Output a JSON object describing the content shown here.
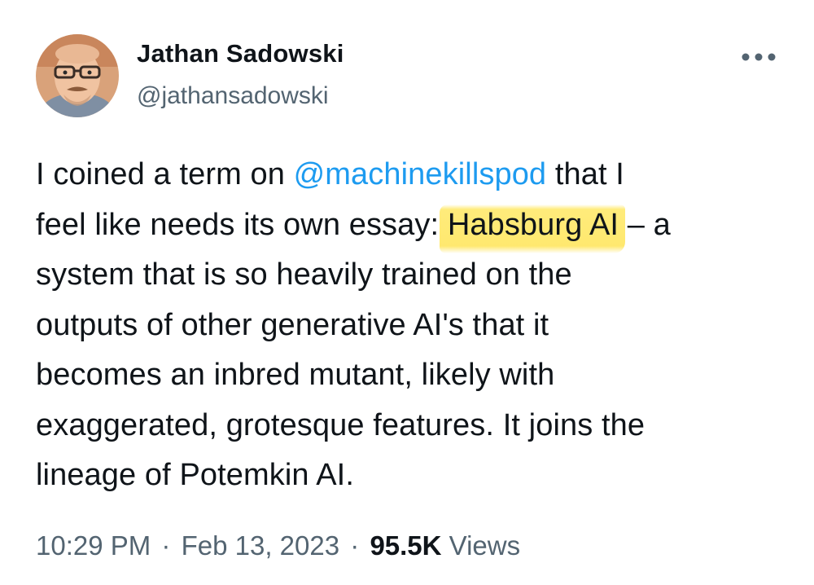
{
  "author": {
    "display_name": "Jathan Sadowski",
    "handle": "@jathansadowski",
    "avatar_icon": "profile-photo-icon"
  },
  "more_icon": "ellipsis-icon",
  "tweet": {
    "lines": [
      [
        {
          "text": "I coined a term on ",
          "type": "text"
        },
        {
          "text": "@machinekillspod",
          "type": "mention"
        },
        {
          "text": " that I",
          "type": "text"
        }
      ],
      [
        {
          "text": "feel like needs its own essay: ",
          "type": "text"
        },
        {
          "text": "Habsburg AI",
          "type": "highlight"
        },
        {
          "text": " – a",
          "type": "text"
        }
      ],
      [
        {
          "text": "system that is so heavily trained on the",
          "type": "text"
        }
      ],
      [
        {
          "text": "outputs of other generative AI's that it",
          "type": "text"
        }
      ],
      [
        {
          "text": "becomes an inbred mutant, likely with",
          "type": "text"
        }
      ],
      [
        {
          "text": "exaggerated, grotesque features. It joins the",
          "type": "text"
        }
      ],
      [
        {
          "text": "lineage of Potemkin AI.",
          "type": "text"
        }
      ]
    ]
  },
  "meta": {
    "time": "10:29 PM",
    "separator": "·",
    "date": "Feb 13, 2023",
    "views_count": "95.5K",
    "views_label": "Views"
  },
  "colors": {
    "link": "#1d9bf0",
    "secondary_text": "#536471",
    "primary_text": "#0f1419",
    "highlight": "#ffe45f"
  }
}
